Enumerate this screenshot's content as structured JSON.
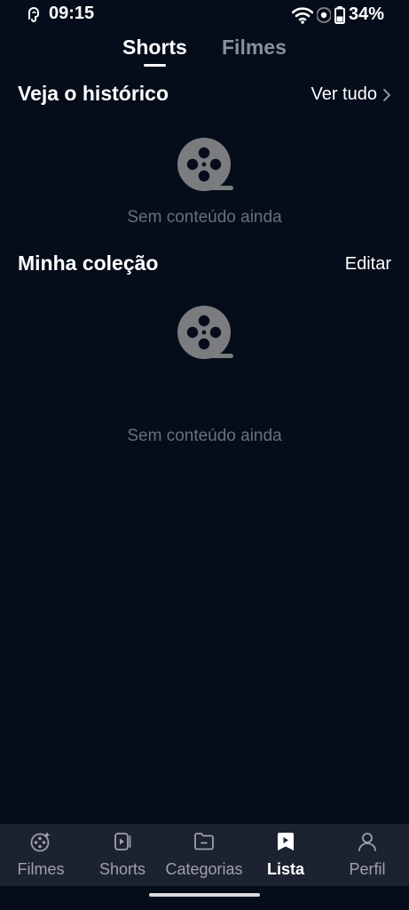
{
  "status_bar": {
    "time": "09:15",
    "battery": "34%"
  },
  "top_tabs": [
    {
      "label": "Shorts",
      "active": true
    },
    {
      "label": "Filmes",
      "active": false
    }
  ],
  "history": {
    "title": "Veja o histórico",
    "action": "Ver tudo",
    "empty_text": "Sem conteúdo ainda"
  },
  "collection": {
    "title": "Minha coleção",
    "action": "Editar",
    "empty_text": "Sem conteúdo ainda"
  },
  "bottom_nav": [
    {
      "label": "Filmes",
      "icon": "film-reel-icon",
      "active": false
    },
    {
      "label": "Shorts",
      "icon": "shorts-play-icon",
      "active": false
    },
    {
      "label": "Categorias",
      "icon": "folder-icon",
      "active": false
    },
    {
      "label": "Lista",
      "icon": "bookmark-play-icon",
      "active": true
    },
    {
      "label": "Perfil",
      "icon": "person-icon",
      "active": false
    }
  ],
  "colors": {
    "background": "#050d1a",
    "nav_background": "#1c2230",
    "muted_text": "#6b6f77",
    "inactive_tab": "#8b8f98"
  }
}
